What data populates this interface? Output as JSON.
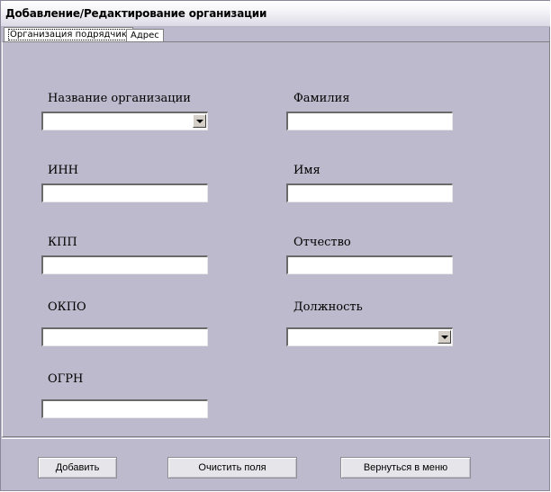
{
  "window": {
    "title": "Добавление/Редактирование организации"
  },
  "tabs": [
    {
      "label": "Организация подрядчик",
      "active": true
    },
    {
      "label": "Адрес",
      "active": false
    }
  ],
  "form": {
    "org_name": {
      "label": "Название организации",
      "value": ""
    },
    "inn": {
      "label": "ИНН",
      "value": ""
    },
    "kpp": {
      "label": "КПП",
      "value": ""
    },
    "okpo": {
      "label": "ОКПО",
      "value": ""
    },
    "ogrn": {
      "label": "ОГРН",
      "value": ""
    },
    "last_name": {
      "label": "Фамилия",
      "value": ""
    },
    "first_name": {
      "label": "Имя",
      "value": ""
    },
    "patronymic": {
      "label": "Отчество",
      "value": ""
    },
    "position": {
      "label": "Должность",
      "value": ""
    }
  },
  "buttons": {
    "add": "Добавить",
    "clear": "Очистить поля",
    "back": "Вернуться в меню"
  }
}
